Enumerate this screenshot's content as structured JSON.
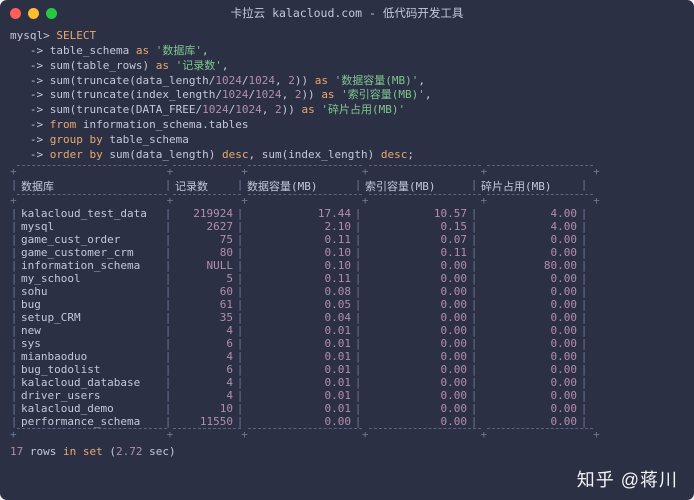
{
  "window": {
    "title": "卡拉云 kalacloud.com - 低代码开发工具"
  },
  "traffic": {
    "close": "close",
    "min": "minimize",
    "max": "maximize"
  },
  "prompt": "mysql> ",
  "arrow": "   -> ",
  "query": {
    "l0": "SELECT",
    "l1_a": "table_schema ",
    "l1_kw": "as",
    "l1_s": " '数据库'",
    "l1_c": ",",
    "l2_a": "sum(table_rows) ",
    "l2_kw": "as",
    "l2_s": " '记录数'",
    "l2_c": ",",
    "l3_a": "sum(truncate(data_length/",
    "l3_n1": "1024",
    "l3_b": "/",
    "l3_n2": "1024",
    "l3_c": ", ",
    "l3_n3": "2",
    "l3_d": ")) ",
    "l3_kw": "as",
    "l3_s": " '数据容量(MB)'",
    "l3_e": ",",
    "l4_a": "sum(truncate(index_length/",
    "l4_n1": "1024",
    "l4_b": "/",
    "l4_n2": "1024",
    "l4_c": ", ",
    "l4_n3": "2",
    "l4_d": ")) ",
    "l4_kw": "as",
    "l4_s": " '索引容量(MB)'",
    "l4_e": ",",
    "l5_a": "sum(truncate(DATA_FREE/",
    "l5_n1": "1024",
    "l5_b": "/",
    "l5_n2": "1024",
    "l5_c": ", ",
    "l5_n3": "2",
    "l5_d": ")) ",
    "l5_kw": "as",
    "l5_s": " '碎片占用(MB)'",
    "l6_kw": "from",
    "l6_a": " information_schema.tables",
    "l7_kw": "group by",
    "l7_a": " table_schema",
    "l8_kw": "order by",
    "l8_a": " sum(data_length) ",
    "l8_kw2": "desc",
    "l8_b": ", sum(index_length) ",
    "l8_kw3": "desc",
    "l8_c": ";"
  },
  "headers": [
    "数据库",
    "记录数",
    "数据容量(MB)",
    "索引容量(MB)",
    "碎片占用(MB)"
  ],
  "rows": [
    {
      "c0": "kalacloud_test_data",
      "c1": "219924",
      "c2": "17.44",
      "c3": "10.57",
      "c4": "4.00"
    },
    {
      "c0": "mysql",
      "c1": "2627",
      "c2": "2.10",
      "c3": "0.15",
      "c4": "4.00"
    },
    {
      "c0": "game_cust_order",
      "c1": "75",
      "c2": "0.11",
      "c3": "0.07",
      "c4": "0.00"
    },
    {
      "c0": "game_customer_crm",
      "c1": "80",
      "c2": "0.10",
      "c3": "0.11",
      "c4": "0.00"
    },
    {
      "c0": "information_schema",
      "c1": "NULL",
      "c2": "0.10",
      "c3": "0.00",
      "c4": "80.00"
    },
    {
      "c0": "my_school",
      "c1": "5",
      "c2": "0.11",
      "c3": "0.00",
      "c4": "0.00"
    },
    {
      "c0": "sohu",
      "c1": "60",
      "c2": "0.08",
      "c3": "0.00",
      "c4": "0.00"
    },
    {
      "c0": "bug",
      "c1": "61",
      "c2": "0.05",
      "c3": "0.00",
      "c4": "0.00"
    },
    {
      "c0": "setup_CRM",
      "c1": "35",
      "c2": "0.04",
      "c3": "0.00",
      "c4": "0.00"
    },
    {
      "c0": "new",
      "c1": "4",
      "c2": "0.01",
      "c3": "0.00",
      "c4": "0.00"
    },
    {
      "c0": "sys",
      "c1": "6",
      "c2": "0.01",
      "c3": "0.00",
      "c4": "0.00"
    },
    {
      "c0": "mianbaoduo",
      "c1": "4",
      "c2": "0.01",
      "c3": "0.00",
      "c4": "0.00"
    },
    {
      "c0": "bug_todolist",
      "c1": "6",
      "c2": "0.01",
      "c3": "0.00",
      "c4": "0.00"
    },
    {
      "c0": "kalacloud_database",
      "c1": "4",
      "c2": "0.01",
      "c3": "0.00",
      "c4": "0.00"
    },
    {
      "c0": "driver_users",
      "c1": "4",
      "c2": "0.01",
      "c3": "0.00",
      "c4": "0.00"
    },
    {
      "c0": "kalacloud_demo",
      "c1": "10",
      "c2": "0.01",
      "c3": "0.00",
      "c4": "0.00"
    },
    {
      "c0": "performance_schema",
      "c1": "11550",
      "c2": "0.00",
      "c3": "0.00",
      "c4": "0.00"
    }
  ],
  "footer": {
    "a": "17",
    "b": " rows ",
    "c": "in set",
    "d": " (",
    "e": "2.72",
    "f": " sec)"
  },
  "watermark": "知乎 @蒋川"
}
